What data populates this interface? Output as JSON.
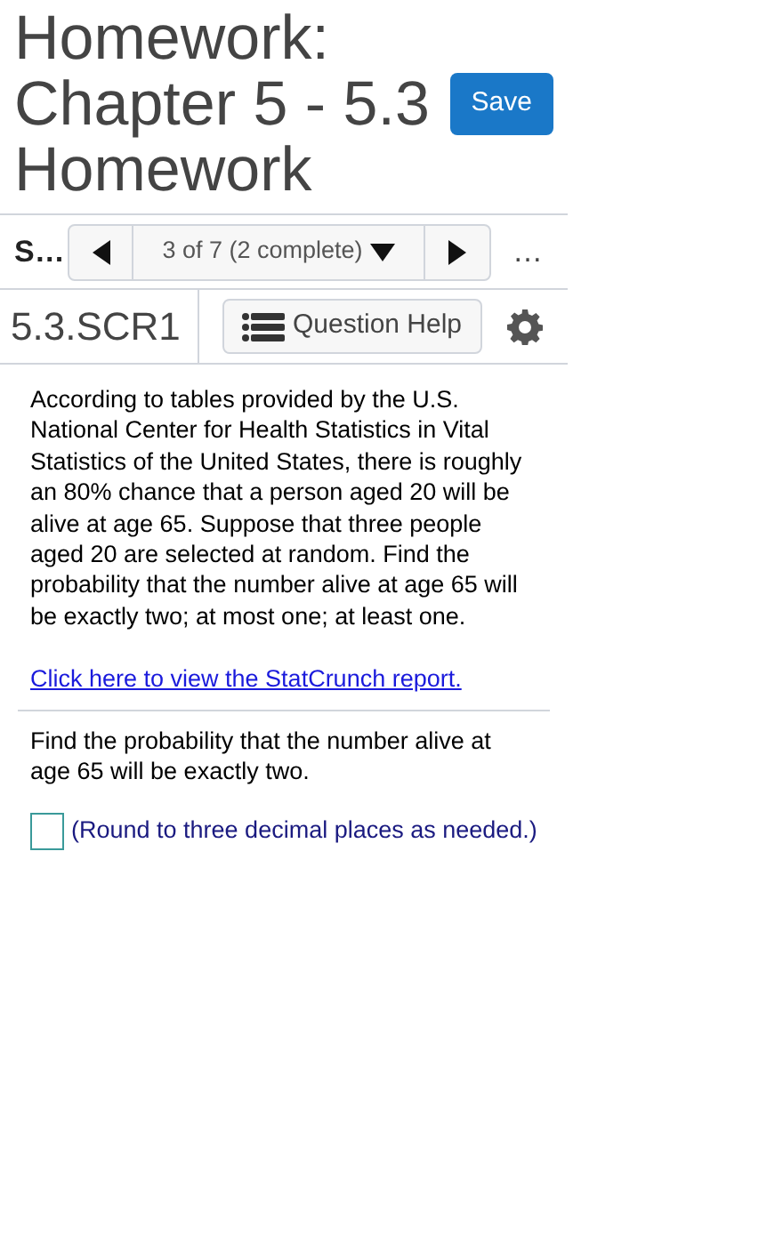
{
  "header": {
    "title": "Homework: Chapter 5 - 5.3 Homework",
    "save_button": "Save"
  },
  "navigation": {
    "section_label": "S…",
    "position": "3 of 7 (2 complete)",
    "more": "…"
  },
  "question_bar": {
    "question_id": "5.3.SCR1",
    "help_button": "Question Help"
  },
  "problem": {
    "text": "According to tables provided by the U.S. National Center for Health Statistics in Vital Statistics of the United States, there is roughly an 80% chance that a person aged 20 will be alive at age 65. Suppose that three people aged 20 are selected at random. Find the probability that the number alive at age 65 will be exactly two; at most one; at least one.",
    "link": "Click here to view the StatCrunch report."
  },
  "question": {
    "text": "Find the probability that the number alive at age 65 will be exactly two.",
    "answer_hint": "(Round to three decimal places as needed.)"
  }
}
